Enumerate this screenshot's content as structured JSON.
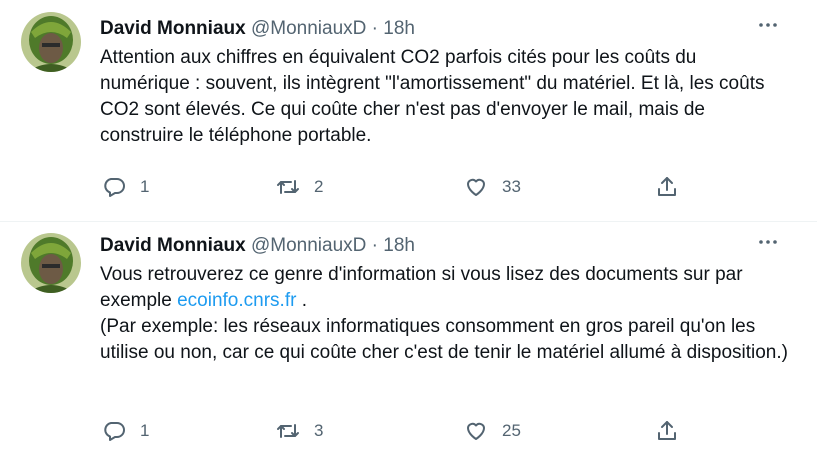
{
  "tweets": [
    {
      "name": "David Monniaux",
      "handle": "@MonniauxD",
      "dot": "·",
      "time": "18h",
      "more_icon": "more-horizontal-icon",
      "text": "Attention aux chiffres en équivalent CO2 parfois cités pour les coûts du numérique : souvent, ils intègrent \"l'amortissement\" du matériel. Et là, les coûts CO2 sont élevés. Ce qui coûte cher n'est pas d'envoyer le mail, mais de construire le téléphone portable.",
      "replies": "1",
      "retweets": "2",
      "likes": "33"
    },
    {
      "name": "David Monniaux",
      "handle": "@MonniauxD",
      "dot": "·",
      "time": "18h",
      "more_icon": "more-horizontal-icon",
      "text_before_link": "Vous retrouverez ce genre d'information si vous lisez des documents sur par exemple ",
      "link": "ecoinfo.cnrs.fr",
      "text_after_link": " .",
      "text_paragraph2": "(Par exemple: les réseaux informatiques consomment en gros pareil qu'on les utilise ou non, car ce qui coûte cher c'est de tenir le matériel allumé à disposition.)",
      "replies": "1",
      "retweets": "3",
      "likes": "25"
    }
  ],
  "colors": {
    "text": "#0f1419",
    "secondary": "#536471",
    "link": "#1d9bf0",
    "separator": "#eff3f4"
  }
}
